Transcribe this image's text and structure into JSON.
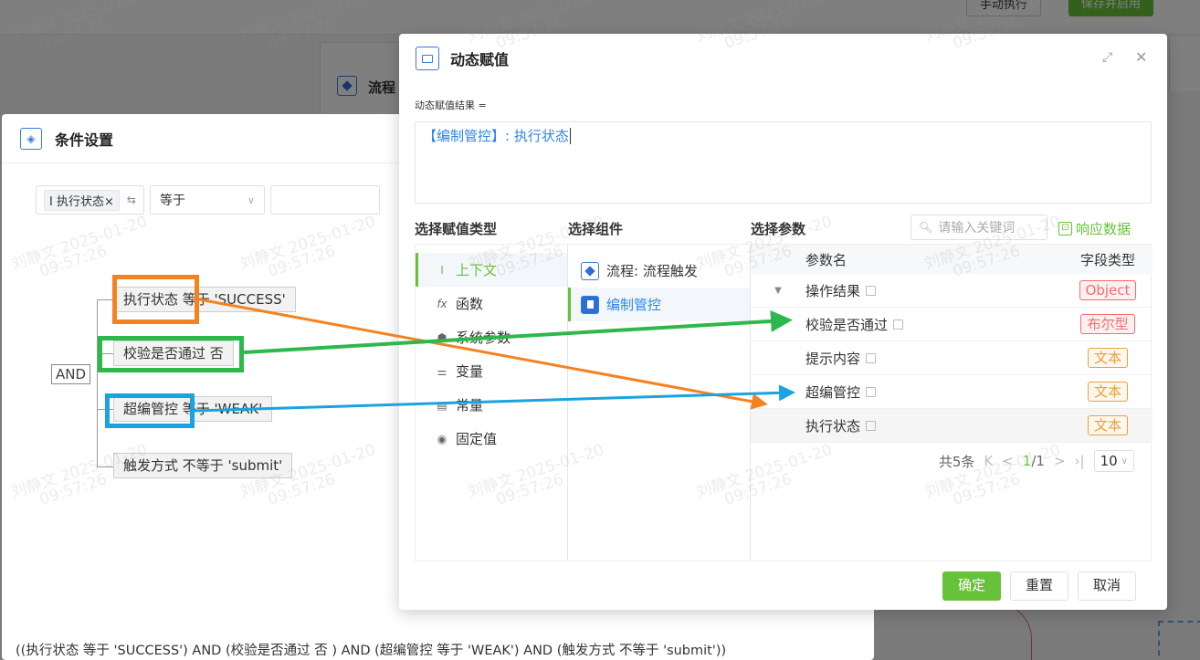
{
  "background": {
    "manual_btn": "手动执行",
    "save_btn": "保存并启用",
    "flow_panel_label": "流程"
  },
  "cond_dialog": {
    "title": "条件设置",
    "chip": "执行状态",
    "chip_close": "×",
    "operator": "等于",
    "and_label": "AND",
    "nodes": [
      "执行状态 等于 'SUCCESS'",
      "校验是否通过 否",
      "超编管控 等于 'WEAK'",
      "触发方式 不等于 'submit'"
    ],
    "expression": "((执行状态 等于 'SUCCESS') AND (校验是否通过 否 ) AND (超编管控 等于 'WEAK') AND (触发方式 不等于 'submit'))"
  },
  "dialog": {
    "title": "动态赋值",
    "result_label": "动态赋值结果 =",
    "result_value": "【编制管控】: 执行状态",
    "col_type_title": "选择赋值类型",
    "col_comp_title": "选择组件",
    "col_param_title": "选择参数",
    "search_placeholder": "请输入关键词",
    "response_data": "响应数据",
    "types": [
      {
        "label": "上下文",
        "icon": "I",
        "active": true
      },
      {
        "label": "函数",
        "icon": "fx",
        "active": false
      },
      {
        "label": "系统参数",
        "icon": "◆",
        "active": false
      },
      {
        "label": "变量",
        "icon": "≡",
        "active": false
      },
      {
        "label": "常量",
        "icon": "▦",
        "active": false
      },
      {
        "label": "固定值",
        "icon": "◉",
        "active": false
      }
    ],
    "components": [
      {
        "label": "流程: 流程触发",
        "active": false
      },
      {
        "label": "编制管控",
        "active": true
      }
    ],
    "param_header": {
      "name": "参数名",
      "type": "字段类型"
    },
    "params": [
      {
        "name": "操作结果",
        "type": "Object",
        "expand": "▼"
      },
      {
        "name": "校验是否通过",
        "type": "布尔型",
        "expand": ""
      },
      {
        "name": "提示内容",
        "type": "文本",
        "expand": ""
      },
      {
        "name": "超编管控",
        "type": "文本",
        "expand": ""
      },
      {
        "name": "执行状态",
        "type": "文本",
        "expand": ""
      }
    ],
    "pager": {
      "total": "共5条",
      "first": "K",
      "prev": "<",
      "page": "1",
      "sep": "/1",
      "next": ">",
      "last": "›|",
      "size": "10"
    },
    "confirm": "确定",
    "reset": "重置",
    "cancel": "取消"
  },
  "watermark": {
    "name": "刘静文",
    "date": "2025-01-20",
    "time": "09:57:26"
  },
  "colors": {
    "accent_green": "#67c23a",
    "blue": "#2b86e8",
    "annot_orange": "#f58220",
    "annot_green": "#2db84c",
    "annot_blue": "#19a3e0"
  }
}
